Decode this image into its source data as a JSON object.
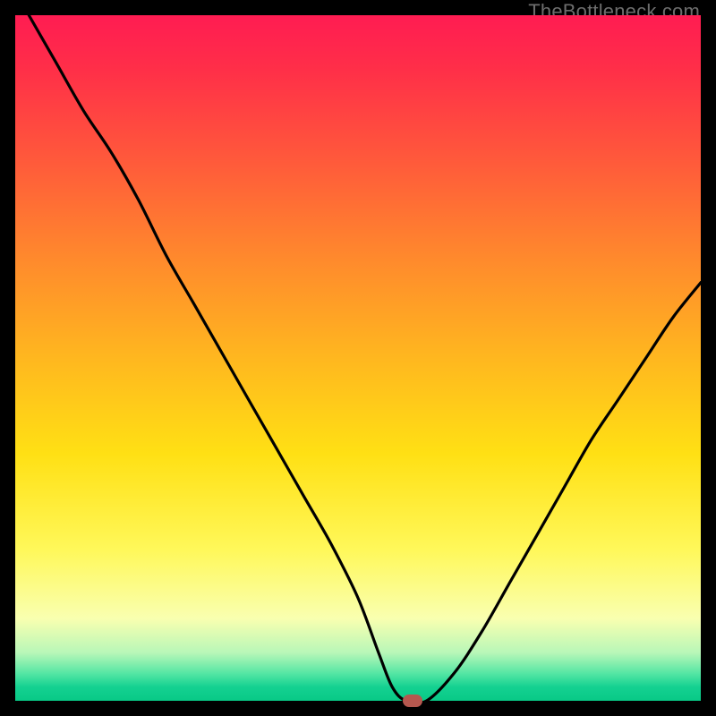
{
  "watermark_text": "TheBottleneck.com",
  "colors": {
    "frame": "#000000",
    "curve_stroke": "#000000",
    "marker": "#b5584f",
    "watermark": "#6d6d6d"
  },
  "chart_data": {
    "type": "line",
    "title": "",
    "xlabel": "",
    "ylabel": "",
    "xlim": [
      0,
      100
    ],
    "ylim": [
      0,
      100
    ],
    "grid": false,
    "legend": false,
    "series": [
      {
        "name": "bottleneck-curve",
        "x": [
          2,
          6,
          10,
          14,
          18,
          22,
          26,
          30,
          34,
          38,
          42,
          46,
          50,
          53,
          55,
          57,
          60,
          64,
          68,
          72,
          76,
          80,
          84,
          88,
          92,
          96,
          100
        ],
        "y": [
          100,
          93,
          86,
          80,
          73,
          65,
          58,
          51,
          44,
          37,
          30,
          23,
          15,
          7,
          2,
          0,
          0,
          4,
          10,
          17,
          24,
          31,
          38,
          44,
          50,
          56,
          61
        ]
      }
    ],
    "marker": {
      "x": 58,
      "y": 0,
      "shape": "rounded-rect",
      "color": "#b5584f"
    },
    "gradient_stops": [
      {
        "pos": 0.0,
        "color": "#ff1c52"
      },
      {
        "pos": 0.22,
        "color": "#ff5c3a"
      },
      {
        "pos": 0.5,
        "color": "#ffb71f"
      },
      {
        "pos": 0.78,
        "color": "#fff85a"
      },
      {
        "pos": 0.93,
        "color": "#b8f7b8"
      },
      {
        "pos": 1.0,
        "color": "#08c986"
      }
    ]
  }
}
